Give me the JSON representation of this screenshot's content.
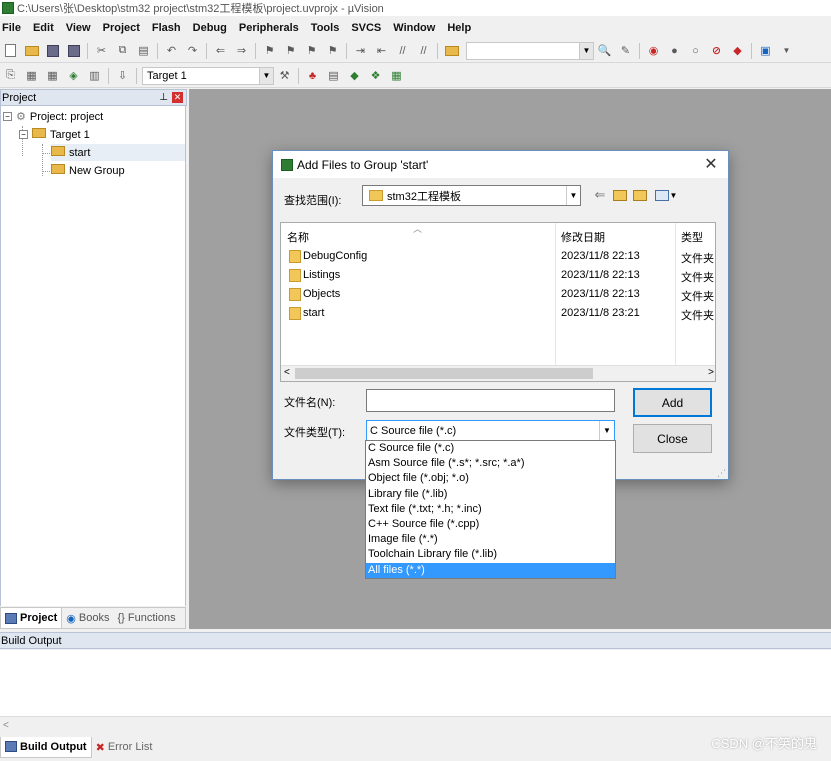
{
  "window": {
    "title": "C:\\Users\\张\\Desktop\\stm32 project\\stm32工程模板\\project.uvprojx - µVision"
  },
  "menu": [
    "File",
    "Edit",
    "View",
    "Project",
    "Flash",
    "Debug",
    "Peripherals",
    "Tools",
    "SVCS",
    "Window",
    "Help"
  ],
  "toolbar": {
    "target_combo": "Target 1"
  },
  "project_panel": {
    "header": "Project",
    "tree": {
      "root": "Project: project",
      "target": "Target 1",
      "groups": [
        "start",
        "New Group"
      ]
    },
    "tabs": [
      "Project",
      "Books",
      "{} Functions"
    ]
  },
  "build_output": {
    "header": "Build Output",
    "scroll_arrow": "<",
    "tabs": [
      "Build Output",
      "Error List"
    ]
  },
  "watermark": "CSDN @不笑的鬼",
  "dialog": {
    "title": "Add Files to Group 'start'",
    "lookin_label": "查找范围(I):",
    "lookin_value": "stm32工程模板",
    "columns": {
      "name": "名称",
      "date": "修改日期",
      "type": "类型"
    },
    "files": [
      {
        "name": "DebugConfig",
        "date": "2023/11/8 22:13",
        "type": "文件夹"
      },
      {
        "name": "Listings",
        "date": "2023/11/8 22:13",
        "type": "文件夹"
      },
      {
        "name": "Objects",
        "date": "2023/11/8 22:13",
        "type": "文件夹"
      },
      {
        "name": "start",
        "date": "2023/11/8 23:21",
        "type": "文件夹"
      }
    ],
    "filename_label": "文件名(N):",
    "filename_value": "",
    "filetype_label": "文件类型(T):",
    "filetype_value": "C Source file (*.c)",
    "add_button": "Add",
    "close_button": "Close",
    "filetype_options": [
      "C Source file (*.c)",
      "Asm Source file (*.s*; *.src; *.a*)",
      "Object file (*.obj; *.o)",
      "Library file (*.lib)",
      "Text file (*.txt; *.h; *.inc)",
      "C++ Source file (*.cpp)",
      "Image file (*.*)",
      "Toolchain Library file (*.lib)",
      "All files (*.*)"
    ],
    "highlighted_option": "All files (*.*)"
  },
  "colors": {
    "accent": "#3399ff",
    "workspace": "#a0a0a0",
    "panel_header": "#dfe6f0"
  }
}
